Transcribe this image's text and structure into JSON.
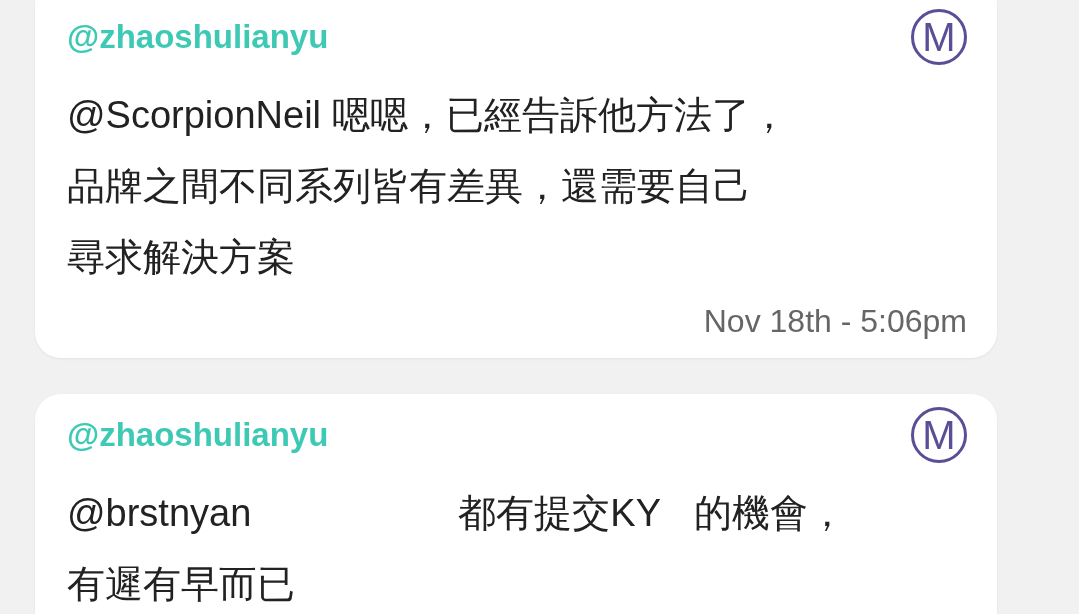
{
  "posts": [
    {
      "author": "@zhaoshulianyu",
      "badge": "M",
      "body_lines": [
        [
          "@ScorpionNeil 嗯嗯，已經告訴他方法了，"
        ],
        [
          "品牌之間不同系列皆有差異，還需要自己"
        ],
        [
          "尋求解決方案"
        ]
      ],
      "timestamp": "Nov 18th - 5:06pm"
    },
    {
      "author": "@zhaoshulianyu",
      "badge": "M",
      "body_lines": [
        [
          "@brstnyan",
          "都有提交KY",
          "的機會，"
        ],
        [
          "有遲有早而已"
        ]
      ]
    }
  ]
}
